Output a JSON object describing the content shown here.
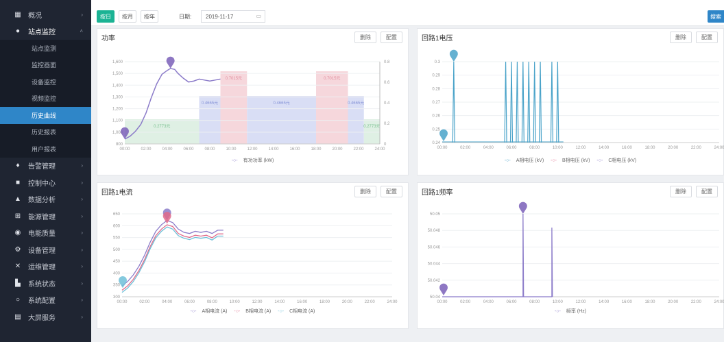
{
  "sidebar": {
    "items": [
      {
        "label": "概况",
        "icon": "dashboard-icon",
        "glyph": "▦",
        "chevron": "›"
      },
      {
        "label": "站点监控",
        "icon": "monitor-icon",
        "glyph": "●",
        "chevron": "˄",
        "open": true,
        "children": [
          "站点监测",
          "监控画面",
          "设备监控",
          "视频监控",
          "历史曲线",
          "历史报表",
          "用户报表"
        ]
      },
      {
        "label": "告警管理",
        "icon": "alarm-icon",
        "glyph": "♦",
        "chevron": "›"
      },
      {
        "label": "控制中心",
        "icon": "control-icon",
        "glyph": "■",
        "chevron": "›"
      },
      {
        "label": "数据分析",
        "icon": "analysis-icon",
        "glyph": "▲",
        "chevron": "›"
      },
      {
        "label": "能源管理",
        "icon": "energy-icon",
        "glyph": "⊞",
        "chevron": "›"
      },
      {
        "label": "电能质量",
        "icon": "quality-icon",
        "glyph": "◉",
        "chevron": "›"
      },
      {
        "label": "设备管理",
        "icon": "device-icon",
        "glyph": "⚙",
        "chevron": "›"
      },
      {
        "label": "运维管理",
        "icon": "tools-icon",
        "glyph": "✕",
        "chevron": "›"
      },
      {
        "label": "系统状态",
        "icon": "bar-chart-icon",
        "glyph": "▙",
        "chevron": "›"
      },
      {
        "label": "系统配置",
        "icon": "settings-icon",
        "glyph": "○",
        "chevron": "›"
      },
      {
        "label": "大屏服务",
        "icon": "screen-icon",
        "glyph": "▤",
        "chevron": "›"
      }
    ],
    "active_child": "历史曲线"
  },
  "toolbar": {
    "day": "按日",
    "month": "按月",
    "year": "按年",
    "date_label": "日期:",
    "date_value": "2019-11-17",
    "calendar_glyph": "▭",
    "search": "搜索"
  },
  "panels": {
    "delete_label": "删除",
    "config_label": "配置",
    "power": {
      "title": "功率",
      "legend": [
        "有功功率 (kW)"
      ]
    },
    "voltage": {
      "title": "回路1电压",
      "legend": [
        "A相电压 (kV)",
        "B相电压 (kV)",
        "C相电压 (kV)"
      ]
    },
    "current": {
      "title": "回路1电流",
      "legend": [
        "A相电流 (A)",
        "B相电流 (A)",
        "C相电流 (A)"
      ]
    },
    "frequency": {
      "title": "回路1频率",
      "legend": [
        "频率 (Hz)"
      ]
    }
  },
  "colors": {
    "accent": "#1bb394",
    "active": "#2f86c8",
    "power_line": "#8b7bc9",
    "voltage_line": "#4aa3c9",
    "tariff_peak": "#f6d7dc",
    "tariff_flat": "#d9def5",
    "tariff_valley": "#dff0e4"
  },
  "chart_data": [
    {
      "id": "power",
      "type": "line",
      "x": [
        "00:00",
        "02:00",
        "04:00",
        "06:00",
        "08:00",
        "10:00",
        "12:00",
        "14:00",
        "16:00",
        "18:00",
        "20:00",
        "22:00",
        "24:00"
      ],
      "series": [
        {
          "name": "有功功率 (kW)",
          "points": [
            [
              0,
              850
            ],
            [
              0.5,
              880
            ],
            [
              1,
              930
            ],
            [
              1.5,
              1000
            ],
            [
              2,
              1120
            ],
            [
              2.5,
              1280
            ],
            [
              3,
              1420
            ],
            [
              3.5,
              1520
            ],
            [
              4,
              1560
            ],
            [
              4.3,
              1580
            ],
            [
              4.7,
              1570
            ],
            [
              5,
              1530
            ],
            [
              5.5,
              1480
            ],
            [
              6,
              1440
            ],
            [
              6.5,
              1450
            ],
            [
              7,
              1470
            ],
            [
              7.5,
              1460
            ],
            [
              8,
              1450
            ],
            [
              8.5,
              1460
            ],
            [
              9,
              1470
            ]
          ]
        }
      ],
      "markers": [
        {
          "label": "max",
          "x": 4.3,
          "y": 1580
        },
        {
          "label": "min",
          "x": 0,
          "y": 850
        }
      ],
      "tariff_bands": [
        {
          "from": 0,
          "to": 7,
          "kind": "valley",
          "price": "0.2773元"
        },
        {
          "from": 7,
          "to": 9,
          "kind": "flat",
          "price": "0.4665元"
        },
        {
          "from": 9,
          "to": 11.5,
          "kind": "peak",
          "price": "0.7015元"
        },
        {
          "from": 11.5,
          "to": 18,
          "kind": "flat",
          "price": "0.4665元"
        },
        {
          "from": 18,
          "to": 21,
          "kind": "peak",
          "price": "0.7015元"
        },
        {
          "from": 21,
          "to": 22.5,
          "kind": "flat",
          "price": "0.4665元"
        },
        {
          "from": 22.5,
          "to": 24,
          "kind": "valley",
          "price": "0.2773元"
        }
      ],
      "y_ticks": [
        "800",
        "1,000",
        "1,100",
        "1,200",
        "1,300",
        "1,400",
        "1,500",
        "1,600"
      ],
      "y2_ticks": [
        "0",
        "0.2",
        "0.4",
        "0.6",
        "0.8"
      ],
      "ylim": [
        800,
        1650
      ]
    },
    {
      "id": "voltage",
      "type": "line",
      "x": [
        "00:00",
        "02:00",
        "04:00",
        "06:00",
        "08:00",
        "10:00",
        "12:00",
        "14:00",
        "16:00",
        "18:00",
        "20:00",
        "22:00",
        "24:00"
      ],
      "spikes_at": [
        1,
        5.5,
        6,
        6.5,
        7,
        7.5,
        8,
        8.5,
        9.5,
        10
      ],
      "y_ticks": [
        "0.24",
        "0.25",
        "0.26",
        "0.27",
        "0.28",
        "0.29",
        "0.3"
      ],
      "ylim": [
        0.24,
        0.3
      ]
    },
    {
      "id": "current",
      "type": "line",
      "x": [
        "00:00",
        "02:00",
        "04:00",
        "06:00",
        "08:00",
        "10:00",
        "12:00",
        "14:00",
        "16:00",
        "18:00",
        "20:00",
        "22:00",
        "24:00"
      ],
      "series": [
        {
          "name": "A相电流 (A)",
          "points": [
            [
              0,
              340
            ],
            [
              0.5,
              360
            ],
            [
              1,
              390
            ],
            [
              1.5,
              430
            ],
            [
              2,
              480
            ],
            [
              2.5,
              540
            ],
            [
              3,
              590
            ],
            [
              3.5,
              620
            ],
            [
              4,
              640
            ],
            [
              4.5,
              630
            ],
            [
              5,
              600
            ],
            [
              5.5,
              585
            ],
            [
              6,
              580
            ],
            [
              6.5,
              590
            ],
            [
              7,
              585
            ],
            [
              7.5,
              590
            ],
            [
              8,
              580
            ],
            [
              8.5,
              595
            ],
            [
              9,
              595
            ]
          ]
        },
        {
          "name": "B相电流 (A)",
          "points": [
            [
              0,
              320
            ],
            [
              0.5,
              340
            ],
            [
              1,
              370
            ],
            [
              1.5,
              410
            ],
            [
              2,
              460
            ],
            [
              2.5,
              520
            ],
            [
              3,
              570
            ],
            [
              3.5,
              600
            ],
            [
              4,
              620
            ],
            [
              4.5,
              612
            ],
            [
              5,
              580
            ],
            [
              5.5,
              568
            ],
            [
              6,
              562
            ],
            [
              6.5,
              572
            ],
            [
              7,
              568
            ],
            [
              7.5,
              572
            ],
            [
              8,
              560
            ],
            [
              8.5,
              578
            ],
            [
              9,
              578
            ]
          ]
        },
        {
          "name": "C相电流 (A)",
          "points": [
            [
              0,
              310
            ],
            [
              0.5,
              330
            ],
            [
              1,
              360
            ],
            [
              1.5,
              400
            ],
            [
              2,
              450
            ],
            [
              2.5,
              510
            ],
            [
              3,
              560
            ],
            [
              3.5,
              590
            ],
            [
              4,
              610
            ],
            [
              4.5,
              600
            ],
            [
              5,
              570
            ],
            [
              5.5,
              558
            ],
            [
              6,
              552
            ],
            [
              6.5,
              562
            ],
            [
              7,
              558
            ],
            [
              7.5,
              562
            ],
            [
              8,
              550
            ],
            [
              8.5,
              568
            ],
            [
              9,
              568
            ]
          ]
        }
      ],
      "y_ticks": [
        "300",
        "350",
        "400",
        "450",
        "500",
        "550",
        "600",
        "650"
      ],
      "ylim": [
        290,
        670
      ]
    },
    {
      "id": "frequency",
      "type": "line",
      "x": [
        "00:00",
        "02:00",
        "04:00",
        "06:00",
        "08:00",
        "10:00",
        "12:00",
        "14:00",
        "16:00",
        "18:00",
        "20:00",
        "22:00",
        "24:00"
      ],
      "series": [
        {
          "name": "频率 (Hz)",
          "points": [
            [
              0,
              50.04
            ],
            [
              7,
              50.04
            ],
            [
              7,
              50.052
            ],
            [
              7.05,
              50.04
            ],
            [
              9.5,
              50.04
            ],
            [
              9.5,
              50.05
            ],
            [
              9.55,
              50.04
            ]
          ]
        }
      ],
      "y_ticks": [
        "50.04",
        "50.042",
        "50.044",
        "50.046",
        "50.048",
        "50.05"
      ],
      "ylim": [
        50.04,
        50.052
      ]
    }
  ]
}
